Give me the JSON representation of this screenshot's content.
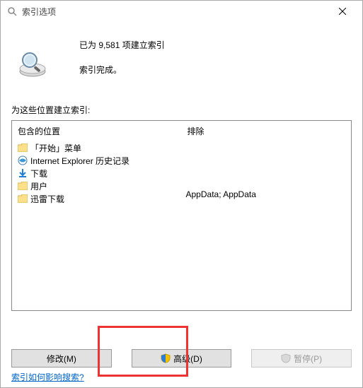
{
  "titlebar": {
    "title": "索引选项"
  },
  "status": {
    "line1": "已为 9,581 项建立索引",
    "line2": "索引完成。"
  },
  "section_label": "为这些位置建立索引:",
  "columns": {
    "included_header": "包含的位置",
    "excluded_header": "排除"
  },
  "included": [
    {
      "icon": "folder",
      "label": "「开始」菜单"
    },
    {
      "icon": "ie",
      "label": "Internet Explorer 历史记录"
    },
    {
      "icon": "down",
      "label": "下载"
    },
    {
      "icon": "folder",
      "label": "用户"
    },
    {
      "icon": "folder",
      "label": "迅雷下载"
    }
  ],
  "excluded_text": "AppData; AppData",
  "buttons": {
    "modify": "修改(M)",
    "advanced": "高级(D)",
    "pause": "暂停(P)"
  },
  "help_link": "索引如何影响搜索?"
}
